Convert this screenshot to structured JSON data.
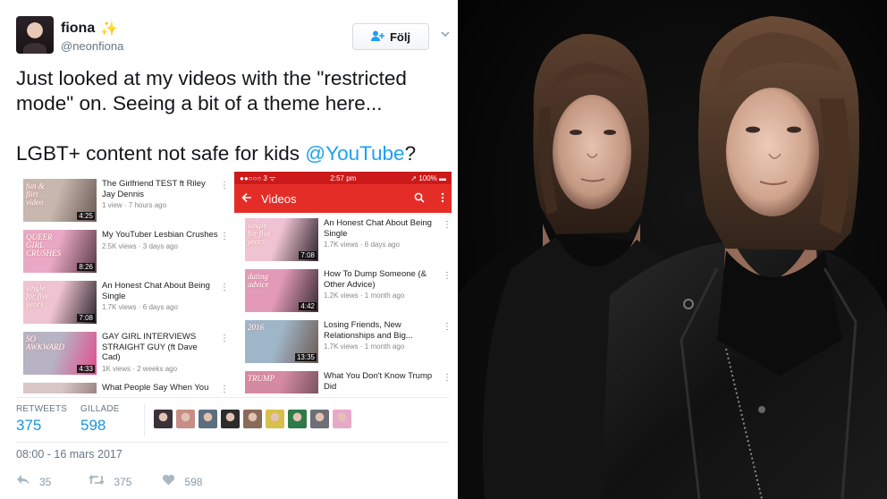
{
  "tweet": {
    "display_name": "fiona",
    "handle": "@neonfiona",
    "sparkle_icon": "sparkle-icon",
    "follow_label": "Följ",
    "text_line1": "Just looked at my videos with the \"restricted mode\" on. Seeing a bit of a theme here...",
    "text_line2_prefix": "LGBT+ content not safe for kids ",
    "text_mention": "@YouTube",
    "text_line2_suffix": "?",
    "retweets_label": "RETWEETS",
    "retweets_value": "375",
    "likes_label": "GILLADE",
    "likes_value": "598",
    "timestamp": "08:00 - 16 mars 2017",
    "reply_count": "35",
    "retweet_count": "375",
    "like_count": "598"
  },
  "left_videos": [
    {
      "title": "The Girlfriend TEST ft Riley Jay Dennis",
      "meta": "1 view · 7 hours ago",
      "duration": "4:25",
      "thumb_text": "fun & flirt video",
      "colors": [
        "#c7b7ae",
        "#6b5a55"
      ]
    },
    {
      "title": "My YouTuber Lesbian Crushes",
      "meta": "2.5K views · 3 days ago",
      "duration": "8:26",
      "thumb_text": "QUEER GIRL CRUSHES",
      "colors": [
        "#e9a8c5",
        "#5a3b46"
      ]
    },
    {
      "title": "An Honest Chat About Being Single",
      "meta": "1.7K views · 6 days ago",
      "duration": "7:08",
      "thumb_text": "single for five years",
      "colors": [
        "#f0c3d2",
        "#2c2529"
      ]
    },
    {
      "title": "GAY GIRL INTERVIEWS STRAIGHT GUY (ft Dave Cad)",
      "meta": "1K views · 2 weeks ago",
      "duration": "4:33",
      "thumb_text": "SO AWKWARD",
      "colors": [
        "#b7b3c4",
        "#e14d8b"
      ]
    },
    {
      "title": "What People Say When You",
      "meta": "",
      "duration": "",
      "thumb_text": "",
      "colors": [
        "#d8c6c6",
        "#8a6f6f"
      ]
    }
  ],
  "phone": {
    "status_left": "●●○○○ 3 ᯤ",
    "status_time": "2:57 pm",
    "status_right": "➚ 100% ▬",
    "bar_title": "Videos",
    "back_icon": "back-arrow-icon",
    "search_icon": "search-icon",
    "more_icon": "more-vertical-icon"
  },
  "right_videos": [
    {
      "title": "An Honest Chat About Being Single",
      "meta": "1.7K views · 6 days ago",
      "duration": "7:08",
      "thumb_text": "single for five years",
      "colors": [
        "#f0c3d2",
        "#2c2529"
      ]
    },
    {
      "title": "How To Dump Someone (& Other Advice)",
      "meta": "1.2K views · 1 month ago",
      "duration": "4:42",
      "thumb_text": "dating advice",
      "colors": [
        "#e39ab8",
        "#3a2c33"
      ]
    },
    {
      "title": "Losing Friends, New Relationships and Big...",
      "meta": "1.7K views · 1 month ago",
      "duration": "13:35",
      "thumb_text": "2016",
      "colors": [
        "#9fb6c9",
        "#6d5a52"
      ]
    },
    {
      "title": "What You Don't Know Trump Did",
      "meta": "",
      "duration": "",
      "thumb_text": "TRUMP",
      "colors": [
        "#d58aa3",
        "#6a4a55"
      ]
    }
  ],
  "likers": [
    "#3a3238",
    "#c98d87",
    "#5c6f7e",
    "#2c2c2c",
    "#8a6a58",
    "#d7c04b",
    "#2f7a4a",
    "#6e6e78",
    "#e7a9c9"
  ]
}
